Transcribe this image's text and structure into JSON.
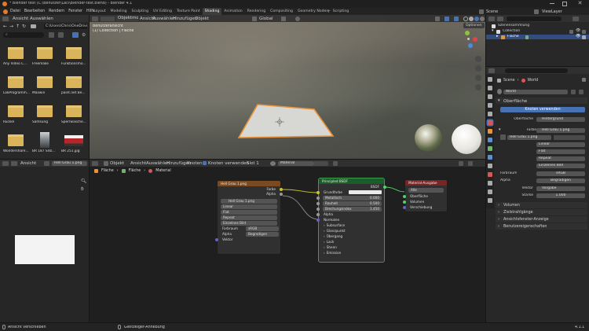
{
  "title_bar": {
    "title": "* Blender test (C:\\Benutzer\\Laci\\Blender-test.blend) - Blender 4.1",
    "app": "Blender 4.1"
  },
  "menu": [
    "Datei",
    "Bearbeiten",
    "Rendern",
    "Fenster",
    "Hilfe"
  ],
  "workspaces": [
    "Layout",
    "Modeling",
    "Sculpting",
    "UV Editing",
    "Texture Paint",
    "Shading",
    "Animation",
    "Rendering",
    "Compositing",
    "Geometry Nodes",
    "Scripting"
  ],
  "active_workspace": "Shading",
  "scene": {
    "label": "Scene",
    "view_layer": "ViewLayer"
  },
  "file_browser": {
    "header": [
      "Ansicht",
      "Auswählen"
    ],
    "path": "C:\\Users\\Chris\\OneDrive\\Doc...",
    "files": [
      {
        "name": "Any Video C...",
        "type": "folder"
      },
      {
        "name": "Freemake",
        "type": "folder"
      },
      {
        "name": "Funktionsmo...",
        "type": "folder"
      },
      {
        "name": "LokProgramm...",
        "type": "folder"
      },
      {
        "name": "Maxwin",
        "type": "folder"
      },
      {
        "name": "paint.net Be...",
        "type": "folder"
      },
      {
        "name": "Ruckel",
        "type": "folder"
      },
      {
        "name": "Samsung",
        "type": "folder"
      },
      {
        "name": "Sperrwasche...",
        "type": "folder"
      },
      {
        "name": "Wondershare...",
        "type": "folder"
      },
      {
        "name": "BR 187 Snb...",
        "type": "image"
      },
      {
        "name": "BR 251.jpg",
        "type": "image"
      }
    ]
  },
  "image_editor": {
    "header": "Ansicht",
    "image": "Hell Grau 1.png"
  },
  "viewport": {
    "header": [
      "Objektmodus",
      "Ansicht",
      "Auswählen",
      "Hinzufügen",
      "Objekt"
    ],
    "transform": "Global",
    "perspective": "Benutzeransicht",
    "collection": "(1) Collection | Fläche",
    "options": "Optionen"
  },
  "node_editor": {
    "header": [
      "Objekt",
      "Ansicht",
      "Auswählen",
      "Hinzufügen",
      "Knoten"
    ],
    "use_nodes": "Knoten verwenden",
    "slot": "Slot 1",
    "material": "Material",
    "breadcrumb": [
      "Fläche",
      "Fläche",
      "Material"
    ],
    "image_node": {
      "title": "Hell Grau 1.png",
      "outputs": [
        "Farbe",
        "Alpha"
      ],
      "image": "Hell Grau 1.png",
      "interpolation": "Linear",
      "projection": "Flat",
      "extension": "Repeat",
      "source": "Einzelnes Bild",
      "color_space_label": "Farbraum",
      "color_space": "sRGB",
      "alpha_label": "Alpha",
      "alpha": "Begradigen",
      "vector": "Vektor"
    },
    "bsdf_node": {
      "title": "Principled BSDF",
      "output": "BSDF",
      "base_color": "Grundfarbe",
      "fields": [
        {
          "label": "Metallisch",
          "value": "0.000"
        },
        {
          "label": "Rauheit",
          "value": "0.500"
        },
        {
          "label": "Brechungsindex",
          "value": "1.450"
        }
      ],
      "alpha": "Alpha",
      "normal": "Normalen",
      "panels": [
        "Subsurface",
        "Glanzpunkt",
        "Übergang",
        "Lack",
        "Shenn",
        "Emission"
      ]
    },
    "output_node": {
      "title": "Material-Ausgabe",
      "target": "Alle",
      "inputs": [
        "Oberfläche",
        "Volumen",
        "Verschiebung"
      ]
    }
  },
  "outliner": {
    "root": "Szenensammlung",
    "items": [
      "Collection",
      "Fläche"
    ]
  },
  "properties": {
    "breadcrumb": [
      "Scene",
      "World"
    ],
    "world_name": "World",
    "surface_section": "Oberfläche",
    "use_nodes_button": "Knoten verwenden",
    "surface_label": "Oberfläche",
    "surface_value": "Hintergrund",
    "color_label": "Farbe",
    "color_value": "Hell Grau 1.png",
    "image_name": "Hell Grau 1.png",
    "interp": "Linear",
    "proj": "Flat",
    "ext": "Repeat",
    "src": "Einzelnes Bild",
    "colorspace_label": "Farbraum",
    "colorspace": "sRGB",
    "alpha_label": "Alpha",
    "alpha": "Begradigen",
    "vector_label": "Vektor",
    "vector": "Vorgabe",
    "strength_label": "Stärke",
    "strength": "1.000",
    "sections": [
      "Volumen",
      "Zielstrahlgänge",
      "Ansichtsfenster-Anzeige",
      "Benutzereigenschaften"
    ]
  },
  "status_bar": {
    "left": "Ansicht verschieben",
    "mid": "Gleitzeiger-Anhebung",
    "version": "4.1.1"
  },
  "colors": {
    "accent": "#4772b3",
    "selection_orange": "#e8923a",
    "image_node_header": "#7a4a22",
    "bsdf_header": "#1c5b2a",
    "output_header": "#7a2424"
  }
}
